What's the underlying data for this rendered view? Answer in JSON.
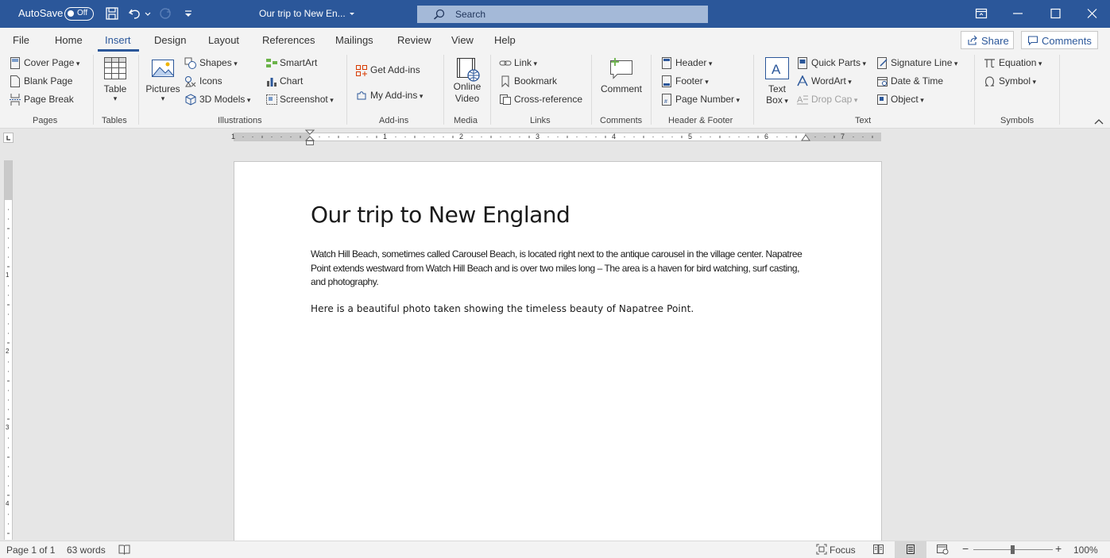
{
  "titlebar": {
    "autosave_label": "AutoSave",
    "autosave_state": "Off",
    "doc_title": "Our trip to New En...",
    "search_placeholder": "Search",
    "bg_color": "#2b579a"
  },
  "tabs": [
    {
      "label": "File"
    },
    {
      "label": "Home"
    },
    {
      "label": "Insert"
    },
    {
      "label": "Design"
    },
    {
      "label": "Layout"
    },
    {
      "label": "References"
    },
    {
      "label": "Mailings"
    },
    {
      "label": "Review"
    },
    {
      "label": "View"
    },
    {
      "label": "Help"
    }
  ],
  "active_tab": "Insert",
  "share_label": "Share",
  "comments_label": "Comments",
  "ribbon": {
    "pages": {
      "label": "Pages",
      "items": [
        "Cover Page",
        "Blank Page",
        "Page Break"
      ]
    },
    "tables": {
      "label": "Tables",
      "table": "Table"
    },
    "illustrations": {
      "label": "Illustrations",
      "pictures": "Pictures",
      "shapes": "Shapes",
      "icons": "Icons",
      "models": "3D Models",
      "smartart": "SmartArt",
      "chart": "Chart",
      "screenshot": "Screenshot"
    },
    "addins": {
      "label": "Add-ins",
      "get": "Get Add-ins",
      "my": "My Add-ins"
    },
    "media": {
      "label": "Media",
      "video_l1": "Online",
      "video_l2": "Video"
    },
    "links": {
      "label": "Links",
      "link": "Link",
      "bookmark": "Bookmark",
      "crossref": "Cross-reference"
    },
    "comments": {
      "label": "Comments",
      "comment": "Comment"
    },
    "headerfooter": {
      "label": "Header & Footer",
      "header": "Header",
      "footer": "Footer",
      "pagenum": "Page Number"
    },
    "text": {
      "label": "Text",
      "textbox_l1": "Text",
      "textbox_l2": "Box",
      "quickparts": "Quick Parts",
      "wordart": "WordArt",
      "dropcap": "Drop Cap",
      "sigline": "Signature Line",
      "datetime": "Date & Time",
      "object": "Object"
    },
    "symbols": {
      "label": "Symbols",
      "equation": "Equation",
      "symbol": "Symbol"
    }
  },
  "ruler_numbers": [
    "1",
    "1",
    "2",
    "3",
    "4",
    "5",
    "6",
    "7"
  ],
  "vruler_numbers": [
    "1",
    "2",
    "3",
    "4"
  ],
  "document": {
    "title": "Our trip to New England",
    "p1": "Watch Hill Beach, sometimes called Carousel Beach, is located right next to the antique carousel in the village center. Napatree Point extends westward from Watch Hill Beach and is over two miles long – The area is a haven for bird watching, surf casting, and photography.",
    "p2": "Here is a beautiful photo taken showing the timeless beauty of Napatree Point."
  },
  "status": {
    "page": "Page 1 of 1",
    "words": "63 words",
    "focus": "Focus",
    "zoom": "100%"
  }
}
